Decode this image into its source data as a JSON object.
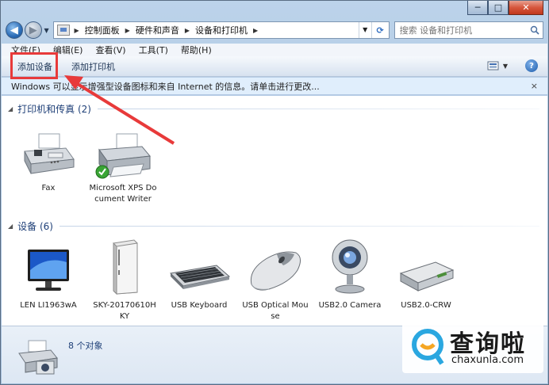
{
  "window": {
    "controls": {
      "minimize": "─",
      "maximize": "□",
      "close": "✕"
    }
  },
  "nav": {
    "back_icon": "back-arrow-icon",
    "forward_icon": "forward-arrow-icon",
    "breadcrumb": [
      "控制面板",
      "硬件和声音",
      "设备和打印机"
    ],
    "search_placeholder": "搜索 设备和打印机"
  },
  "menubar": {
    "items": [
      "文件(F)",
      "编辑(E)",
      "查看(V)",
      "工具(T)",
      "帮助(H)"
    ]
  },
  "toolbar": {
    "add_device": "添加设备",
    "add_printer": "添加打印机"
  },
  "infobar": {
    "message": "Windows 可以显示增强型设备图标和来自 Internet 的信息。请单击进行更改...",
    "close": "×"
  },
  "groups": {
    "printers": {
      "title": "打印机和传真 (2)",
      "items": [
        {
          "label": "Fax",
          "icon": "fax-icon"
        },
        {
          "label": "Microsoft XPS Document Writer",
          "icon": "printer-icon",
          "default": true
        }
      ]
    },
    "devices": {
      "title": "设备 (6)",
      "items": [
        {
          "label": "LEN LI1963wA",
          "icon": "monitor-icon"
        },
        {
          "label": "SKY-20170610HKY",
          "icon": "computer-tower-icon"
        },
        {
          "label": "USB Keyboard",
          "icon": "keyboard-icon"
        },
        {
          "label": "USB Optical Mouse",
          "icon": "mouse-icon"
        },
        {
          "label": "USB2.0 Camera",
          "icon": "webcam-icon"
        },
        {
          "label": "USB2.0-CRW",
          "icon": "card-reader-icon"
        }
      ]
    }
  },
  "details": {
    "count": "8 个对象"
  },
  "watermark": {
    "brand": "查询啦",
    "url": "chaxunla.com"
  },
  "colors": {
    "annotation_red": "#e83a3a",
    "group_title": "#1e3f77",
    "infobar_bg": "#e0eefc"
  }
}
